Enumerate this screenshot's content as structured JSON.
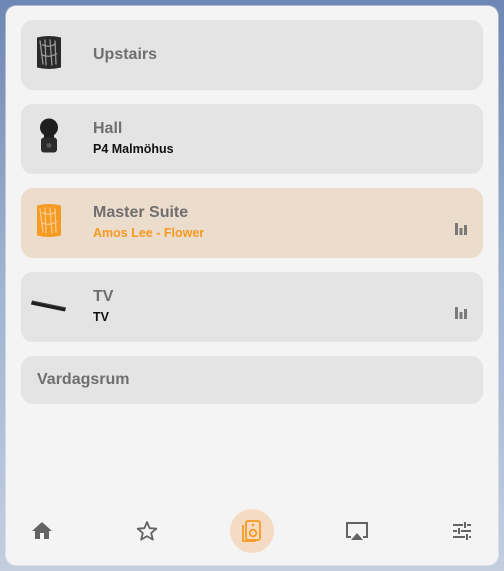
{
  "speakers": [
    {
      "name": "Upstairs",
      "subtitle": ""
    },
    {
      "name": "Hall",
      "subtitle": "P4 Malmöhus"
    },
    {
      "name": "Master Suite",
      "subtitle": "Amos Lee - Flower"
    },
    {
      "name": "TV",
      "subtitle": "TV"
    },
    {
      "name": "Vardagsrum",
      "subtitle": ""
    }
  ],
  "colors": {
    "accent": "#f59a22",
    "active_card": "#ebdccb",
    "card": "#e4e4e5",
    "icon": "#636363"
  },
  "nav": [
    "home-icon",
    "favorites-star-icon",
    "speaker-icon",
    "airplay-icon",
    "settings-sliders-icon"
  ]
}
